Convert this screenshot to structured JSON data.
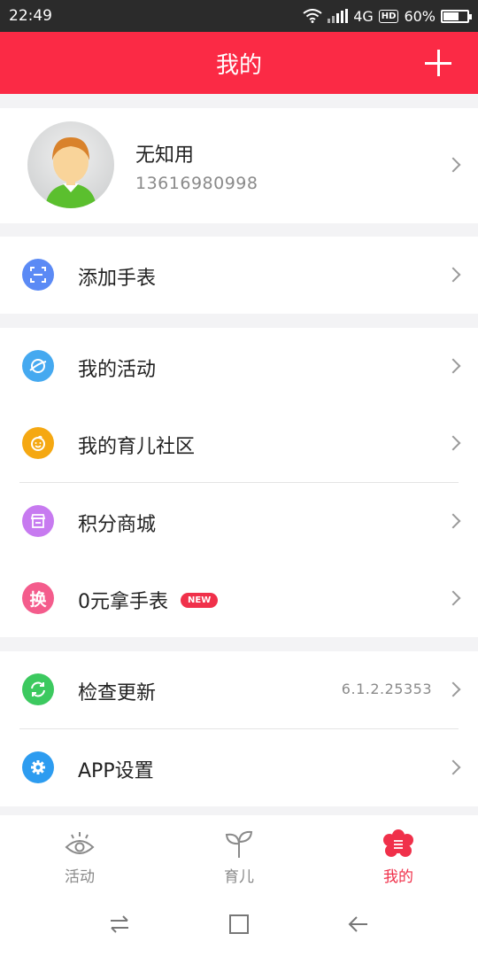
{
  "status_bar": {
    "time": "22:49",
    "network": "4G",
    "hd": "HD",
    "battery": "60%",
    "battery_level": 0.6
  },
  "header": {
    "title": "我的"
  },
  "profile": {
    "name": "无知用",
    "phone": "13616980998"
  },
  "menu": {
    "add_watch": "添加手表",
    "my_activity": "我的活动",
    "parenting_community": "我的育儿社区",
    "points_mall": "积分商城",
    "free_watch": "0元拿手表",
    "free_watch_badge": "NEW",
    "free_watch_icon_char": "换",
    "check_update": "检查更新",
    "version": "6.1.2.25353",
    "app_settings": "APP设置"
  },
  "tabs": [
    {
      "label": "活动",
      "icon": "eye-icon",
      "active": false
    },
    {
      "label": "育儿",
      "icon": "sprout-icon",
      "active": false
    },
    {
      "label": "我的",
      "icon": "flower-menu-icon",
      "active": true
    }
  ],
  "colors": {
    "brand": "#fb2a45",
    "add_watch_icon": "#5b8af5",
    "activity_icon": "#45a9f0",
    "community_icon": "#f5a812",
    "mall_icon": "#c77af0",
    "free_watch_icon": "#f45c8c",
    "update_icon": "#3cc95f",
    "settings_icon": "#2d9cf0"
  }
}
